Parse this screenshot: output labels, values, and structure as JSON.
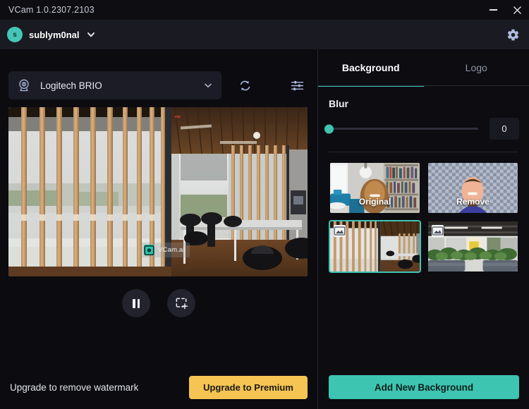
{
  "window": {
    "title": "VCam 1.0.2307.2103",
    "minimize_icon": "minimize-icon",
    "close_icon": "close-icon"
  },
  "account": {
    "avatar_initial": "s",
    "username": "sublym0nal",
    "caret_icon": "chevron-down-icon",
    "settings_icon": "gear-icon"
  },
  "camera": {
    "icon": "webcam-icon",
    "selected_device": "Logitech BRIO",
    "caret_icon": "chevron-down-icon",
    "refresh_icon": "refresh-icon",
    "adjust_icon": "sliders-icon"
  },
  "preview": {
    "watermark_text": "VCam.ai",
    "watermark_logo": "vcam-logo-icon",
    "pause_icon": "pause-icon",
    "snapshot_icon": "crop-add-icon"
  },
  "footer": {
    "watermark_notice": "Upgrade to remove watermark",
    "upgrade_button": "Upgrade to Premium"
  },
  "right_panel": {
    "tabs": [
      {
        "label": "Background",
        "active": true
      },
      {
        "label": "Logo",
        "active": false
      }
    ],
    "blur": {
      "label": "Blur",
      "value": "0",
      "min": 0,
      "max": 100,
      "percent": 0
    },
    "backgrounds": [
      {
        "caption": "Original",
        "selected": false,
        "kind": "original",
        "badge": null
      },
      {
        "caption": "Remove",
        "selected": false,
        "kind": "remove",
        "badge": null
      },
      {
        "caption": "",
        "selected": true,
        "kind": "office-slats",
        "badge": "image-icon"
      },
      {
        "caption": "",
        "selected": false,
        "kind": "office-plants",
        "badge": "image-icon"
      }
    ],
    "add_background_button": "Add New Background"
  },
  "colors": {
    "accent_teal": "#3dc5b1",
    "premium_gold": "#f5c453",
    "icon_blue": "#aebbe0",
    "titlebar_bg": "#0d0d12",
    "accountbar_bg": "#1a1a22",
    "panel_bg": "#0b0b10"
  }
}
